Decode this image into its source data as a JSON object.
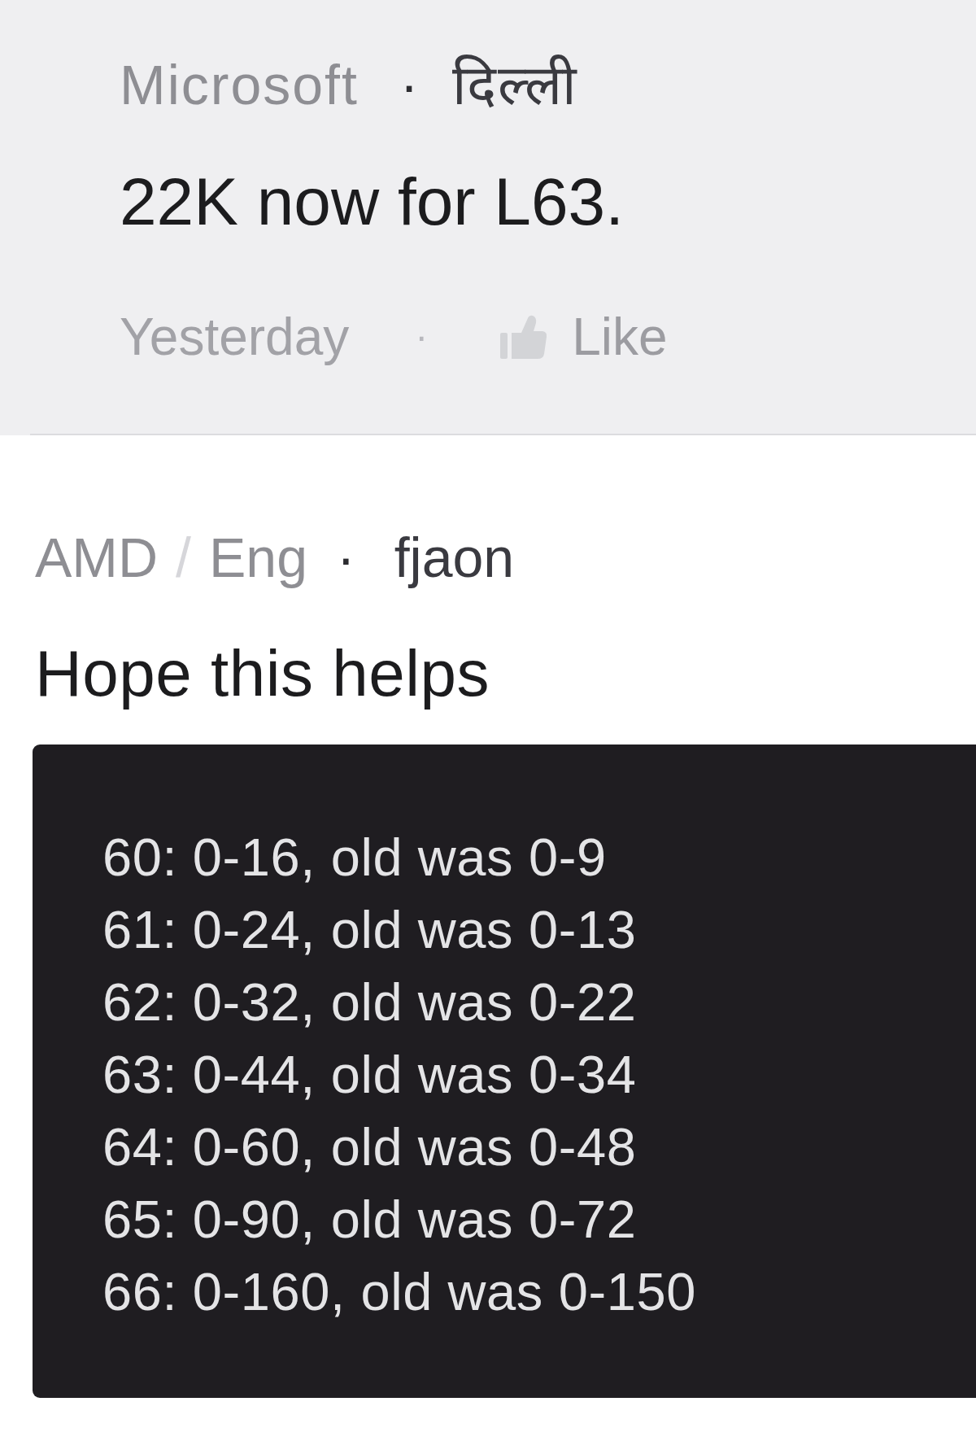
{
  "comments": [
    {
      "kind": "reply",
      "byline": {
        "company": "Microsoft",
        "separator": "·",
        "author": "दिल्ली"
      },
      "body": "22K now for L63.",
      "footer": {
        "time": "Yesterday",
        "separator": "·",
        "like_label": "Like"
      }
    },
    {
      "kind": "post",
      "byline": {
        "company": "AMD",
        "divider": "/",
        "team": "Eng",
        "separator": "·",
        "author": "fjaon"
      },
      "body": "Hope this helps",
      "code_lines": [
        "60: 0-16, old was 0-9",
        "61: 0-24, old was 0-13",
        "62: 0-32, old was 0-22",
        "63: 0-44, old was 0-34",
        "64: 0-60, old was 0-48",
        "65: 0-90, old was 0-72",
        "66: 0-160, old was 0-150"
      ]
    }
  ]
}
